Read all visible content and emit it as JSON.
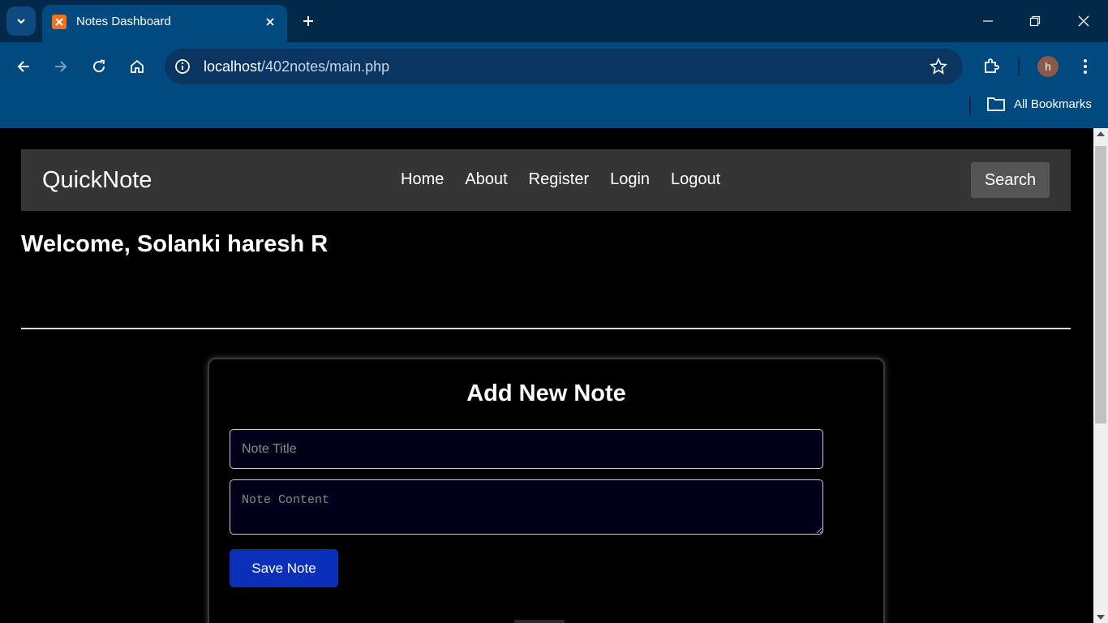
{
  "browser": {
    "tab_title": "Notes Dashboard",
    "url_host": "localhost",
    "url_path": "/402notes/main.php",
    "bookmarks_label": "All Bookmarks",
    "profile_initial": "h"
  },
  "navbar": {
    "brand": "QuickNote",
    "links": [
      "Home",
      "About",
      "Register",
      "Login",
      "Logout"
    ],
    "search_label": "Search"
  },
  "page": {
    "welcome": "Welcome, Solanki haresh R"
  },
  "note_form": {
    "heading": "Add New Note",
    "title_placeholder": "Note Title",
    "title_value": "",
    "content_placeholder": "Note Content",
    "content_value": "",
    "save_label": "Save Note"
  },
  "colors": {
    "navbar_bg": "#353535",
    "save_button": "#0a2fb8",
    "browser_frame": "#004a7f"
  }
}
